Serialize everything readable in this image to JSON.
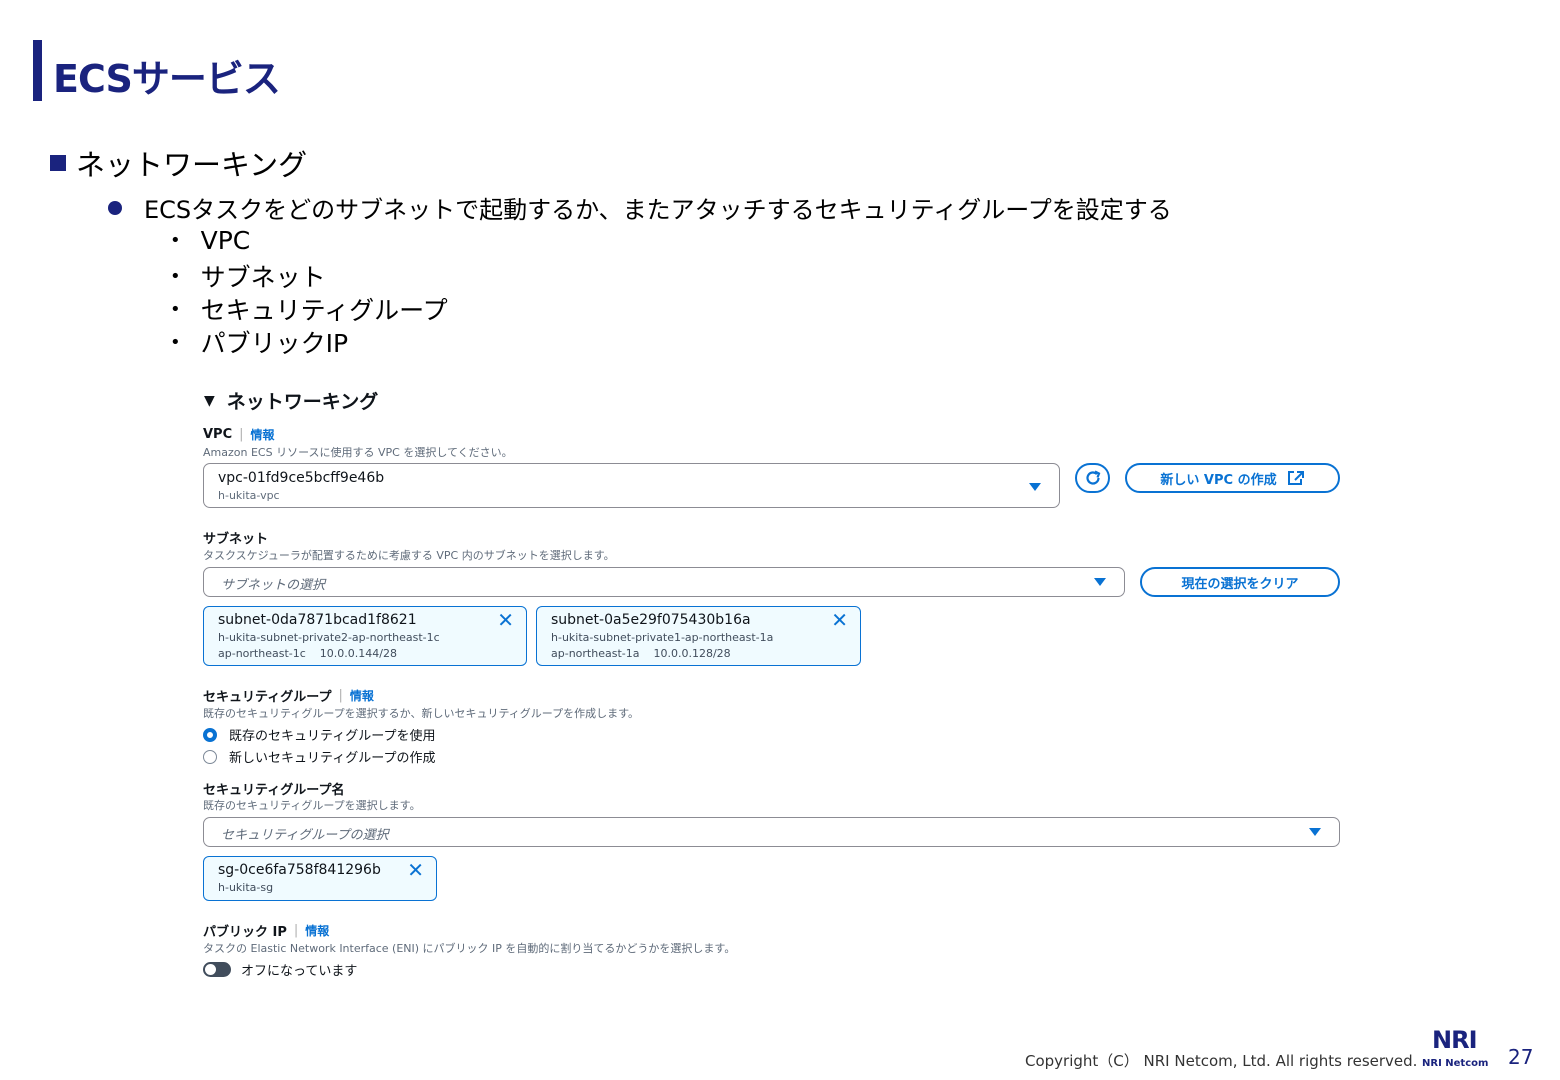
{
  "slide": {
    "title": "ECSサービス",
    "heading": "ネットワーキング",
    "bullet": "ECSタスクをどのサブネットで起動するか、またアタッチするセキュリティグループを設定する",
    "subbullets": [
      "VPC",
      "サブネット",
      "セキュリティグループ",
      "パブリックIP"
    ]
  },
  "panel": {
    "section_title": "ネットワーキング",
    "vpc": {
      "label": "VPC",
      "info": "情報",
      "desc": "Amazon ECS リソースに使用する VPC を選択してください。",
      "value": "vpc-01fd9ce5bcff9e46b",
      "sub": "h-ukita-vpc",
      "create_button": "新しい VPC の作成"
    },
    "subnet": {
      "label": "サブネット",
      "desc": "タスクスケジューラが配置するために考慮する VPC 内のサブネットを選択します。",
      "placeholder": "サブネットの選択",
      "clear_button": "現在の選択をクリア",
      "tokens": [
        {
          "id": "subnet-0da7871bcad1f8621",
          "name": "h-ukita-subnet-private2-ap-northeast-1c",
          "az": "ap-northeast-1c",
          "cidr": "10.0.0.144/28"
        },
        {
          "id": "subnet-0a5e29f075430b16a",
          "name": "h-ukita-subnet-private1-ap-northeast-1a",
          "az": "ap-northeast-1a",
          "cidr": "10.0.0.128/28"
        }
      ]
    },
    "security_group": {
      "label": "セキュリティグループ",
      "info": "情報",
      "desc": "既存のセキュリティグループを選択するか、新しいセキュリティグループを作成します。",
      "options": [
        "既存のセキュリティグループを使用",
        "新しいセキュリティグループの作成"
      ],
      "selected_index": 0
    },
    "security_group_name": {
      "label": "セキュリティグループ名",
      "desc": "既存のセキュリティグループを選択します。",
      "placeholder": "セキュリティグループの選択",
      "token": {
        "id": "sg-0ce6fa758f841296b",
        "name": "h-ukita-sg"
      }
    },
    "public_ip": {
      "label": "パブリック IP",
      "info": "情報",
      "desc": "タスクの Elastic Network Interface (ENI) にパブリック IP を自動的に割り当てるかどうかを選択します。",
      "toggle_label": "オフになっています",
      "enabled": false
    }
  },
  "footer": {
    "copyright": "Copyright（C） NRI Netcom, Ltd. All rights reserved.",
    "logo_text": "NRI",
    "logo_sub": "NRI Netcom",
    "page": "27"
  }
}
